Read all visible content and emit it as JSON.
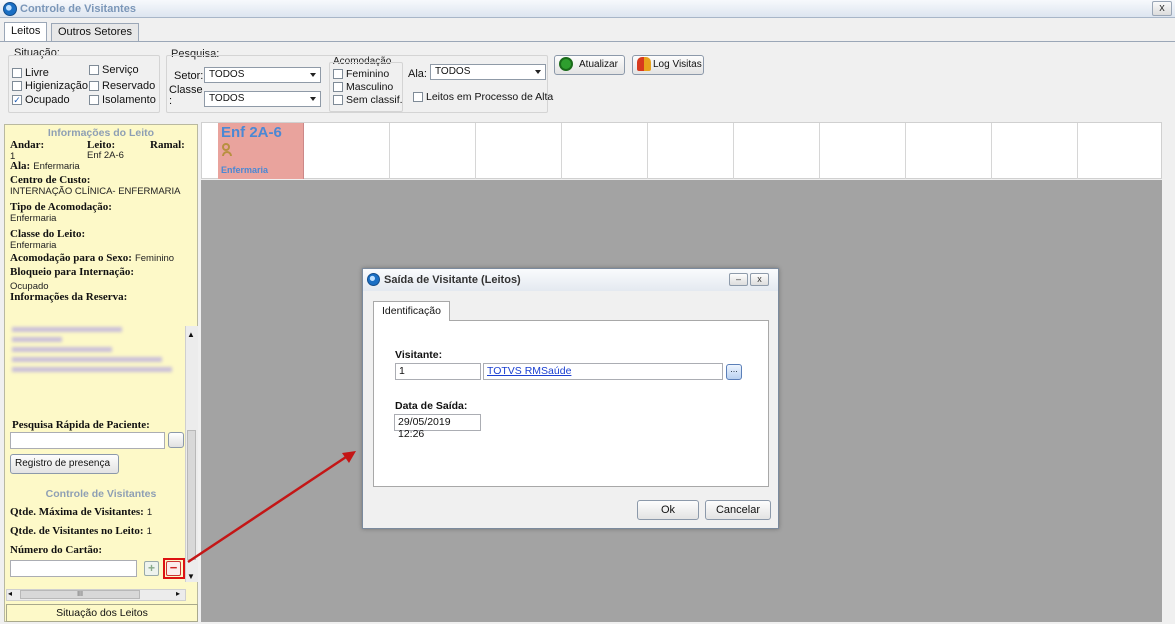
{
  "window": {
    "title": "Controle de Visitantes",
    "close_label": "x"
  },
  "tabs": [
    {
      "label": "Leitos",
      "active": true
    },
    {
      "label": "Outros Setores",
      "active": false
    }
  ],
  "filters": {
    "situacao": {
      "label": "Situação:",
      "options": [
        {
          "label": "Livre",
          "checked": false
        },
        {
          "label": "Serviço",
          "checked": false
        },
        {
          "label": "Higienização",
          "checked": false
        },
        {
          "label": "Reservado",
          "checked": false
        },
        {
          "label": "Ocupado",
          "checked": true
        },
        {
          "label": "Isolamento",
          "checked": false
        }
      ]
    },
    "pesquisa": {
      "label": "Pesquisa:",
      "setor_label": "Setor:",
      "setor_value": "TODOS",
      "classe_label": "Classe",
      "classe_colon": ":",
      "classe_value": "TODOS"
    },
    "acomodacao": {
      "label": "Acomodação",
      "options": [
        {
          "label": "Feminino",
          "checked": false
        },
        {
          "label": "Masculino",
          "checked": false
        },
        {
          "label": "Sem classif.",
          "checked": false
        }
      ]
    },
    "ala": {
      "label": "Ala:",
      "value": "TODOS"
    },
    "leitos_alta": {
      "label": "Leitos em Processo de Alta",
      "checked": false
    },
    "atualizar_label": "Atualizar",
    "log_visitas_label": "Log Visitas"
  },
  "info": {
    "title": "Informações do Leito",
    "andar_label": "Andar:",
    "andar_value": "1",
    "leito_label": "Leito:",
    "leito_value": "Enf 2A-6",
    "ramal_label": "Ramal:",
    "ala_label": "Ala:",
    "ala_value": "Enfermaria",
    "centro_label": "Centro de Custo:",
    "centro_value": "INTERNAÇÃO CLÍNICA- ENFERMARIA",
    "tipo_label": "Tipo de Acomodação:",
    "tipo_value": "Enfermaria",
    "classe_label": "Classe do Leito:",
    "classe_value": "Enfermaria",
    "sexo_label": "Acomodação para o Sexo:",
    "sexo_value": "Feminino",
    "bloqueio_label": "Bloqueio para Internação:",
    "bloqueio_value": "Ocupado",
    "reserva_label": "Informações da Reserva:",
    "pesquisa_rapida_label": "Pesquisa Rápida de Paciente:",
    "registro_label": "Registro de presença",
    "controle_title": "Controle de Visitantes",
    "qtde_max_label": "Qtde. Máxima de Visitantes:",
    "qtde_max_value": "1",
    "qtde_leito_label": "Qtde. de Visitantes no Leito:",
    "qtde_leito_value": "1",
    "cartao_label": "Número do Cartão:",
    "scroll_label": "III",
    "situacao_leitos_label": "Situação dos Leitos"
  },
  "bed": {
    "name": "Enf 2A-6",
    "sub": "Enfermaria"
  },
  "dialog": {
    "title": "Saída de Visitante (Leitos)",
    "tab": "Identificação",
    "visitante_label": "Visitante:",
    "visitante_code": "1",
    "visitante_name": "TOTVS RMSaúde",
    "dots_label": "...",
    "data_saida_label": "Data de Saída:",
    "data_saida_value": "29/05/2019 12:26",
    "ok_label": "Ok",
    "cancel_label": "Cancelar"
  },
  "colors": {
    "bed_occupied": "#e9a39d",
    "bed_text": "#4b88d4",
    "panel_bg": "#fdf9c8",
    "annotation": "#d11111"
  }
}
